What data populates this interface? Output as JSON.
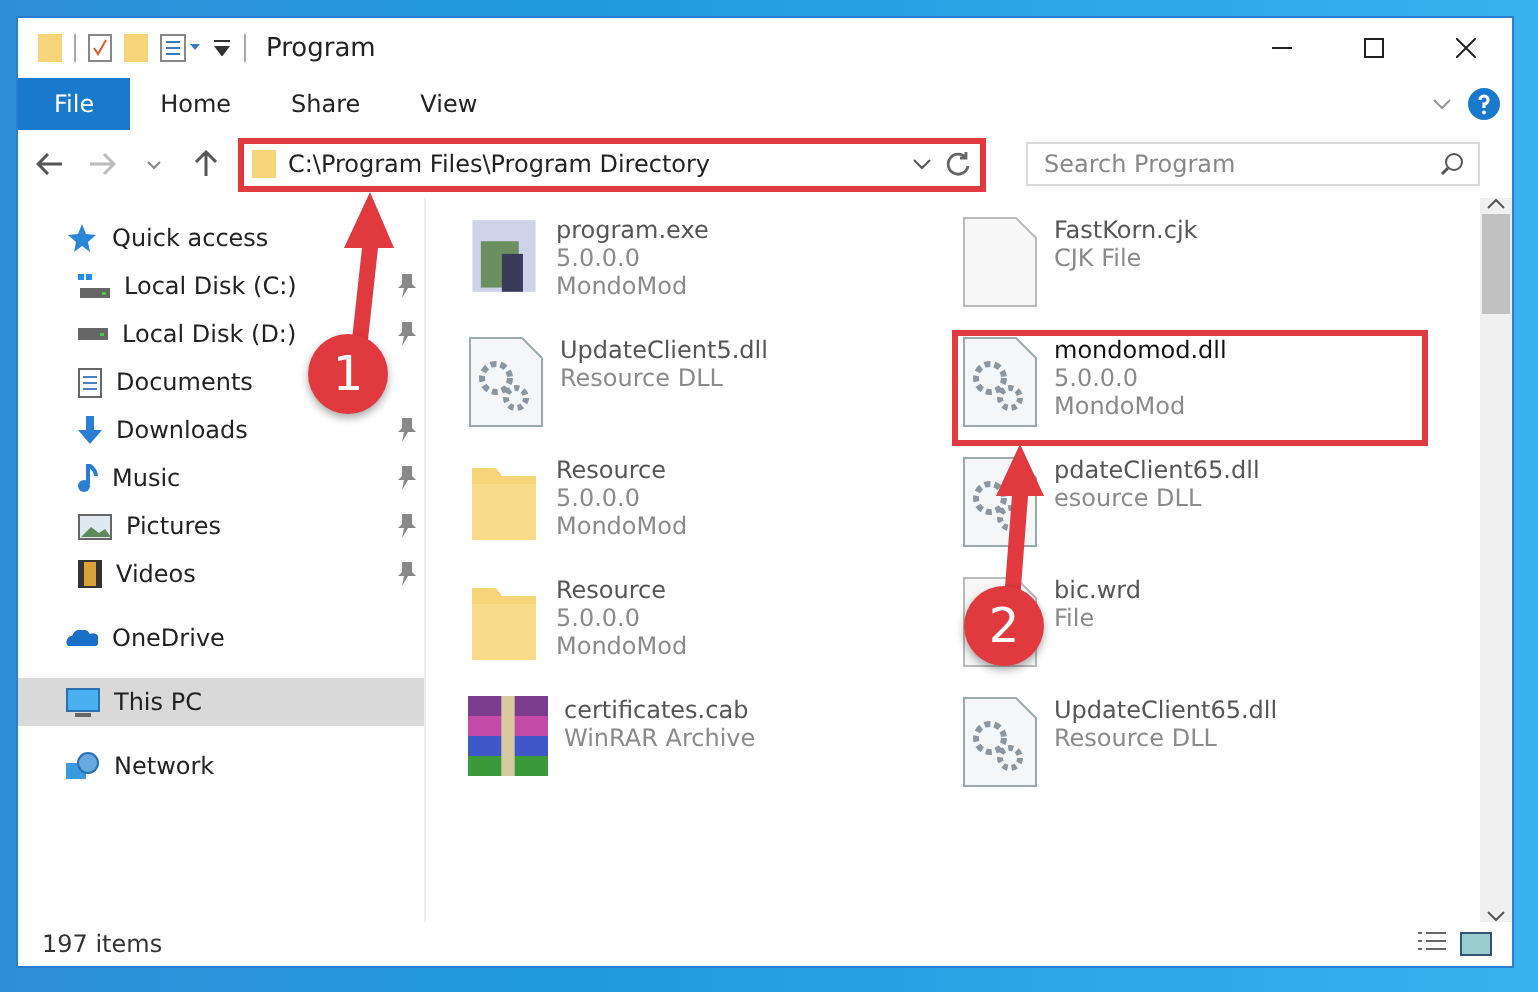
{
  "window": {
    "title": "Program"
  },
  "ribbon_tabs": [
    {
      "label": "File",
      "kind": "file"
    },
    {
      "label": "Home",
      "kind": "tab"
    },
    {
      "label": "Share",
      "kind": "tab"
    },
    {
      "label": "View",
      "kind": "tab"
    }
  ],
  "address": {
    "path": "C:\\Program Files\\Program Directory",
    "highlighted": true
  },
  "search": {
    "placeholder": "Search Program"
  },
  "sidebar": [
    {
      "label": "Quick access",
      "selected": false,
      "children": [
        {
          "label": "Local Disk (C:)",
          "pinned": true,
          "selected": false
        },
        {
          "label": "Local Disk (D:)",
          "pinned": true,
          "selected": false
        },
        {
          "label": "Documents",
          "pinned": false,
          "selected": false
        },
        {
          "label": "Downloads",
          "pinned": true,
          "selected": false
        },
        {
          "label": "Music",
          "pinned": true,
          "selected": false
        },
        {
          "label": "Pictures",
          "pinned": true,
          "selected": false
        },
        {
          "label": "Videos",
          "pinned": true,
          "selected": false
        }
      ]
    },
    {
      "label": "OneDrive",
      "selected": false
    },
    {
      "label": "This PC",
      "selected": true
    },
    {
      "label": "Network",
      "selected": false
    }
  ],
  "files": [
    {
      "name": "program.exe",
      "details": [
        "5.0.0.0",
        "MondoMod"
      ],
      "kind": "program",
      "highlighted": false
    },
    {
      "name": "FastKorn.cjk",
      "details": [
        "CJK File"
      ],
      "kind": "file",
      "highlighted": false
    },
    {
      "name": "UpdateClient5.dll",
      "details": [
        "Resource DLL"
      ],
      "kind": "dll",
      "highlighted": false
    },
    {
      "name": "mondomod.dll",
      "details": [
        "5.0.0.0",
        "MondoMod"
      ],
      "kind": "dll",
      "highlighted": true
    },
    {
      "name": "Resource",
      "details": [
        "5.0.0.0",
        "MondoMod"
      ],
      "kind": "folder",
      "highlighted": false
    },
    {
      "name": "pdateClient65.dll",
      "details": [
        "esource DLL"
      ],
      "kind": "dll",
      "highlighted": false
    },
    {
      "name": "Resource",
      "details": [
        "5.0.0.0",
        "MondoMod"
      ],
      "kind": "folder",
      "highlighted": false
    },
    {
      "name": "bic.wrd",
      "details": [
        "File"
      ],
      "kind": "file",
      "highlighted": false
    },
    {
      "name": "certificates.cab",
      "details": [
        "WinRAR Archive"
      ],
      "kind": "archive",
      "highlighted": false
    },
    {
      "name": "UpdateClient65.dll",
      "details": [
        "Resource DLL"
      ],
      "kind": "dll",
      "highlighted": false
    }
  ],
  "status_bar": {
    "count": "197 items"
  },
  "annotations": [
    {
      "number": "1"
    },
    {
      "number": "2"
    }
  ]
}
